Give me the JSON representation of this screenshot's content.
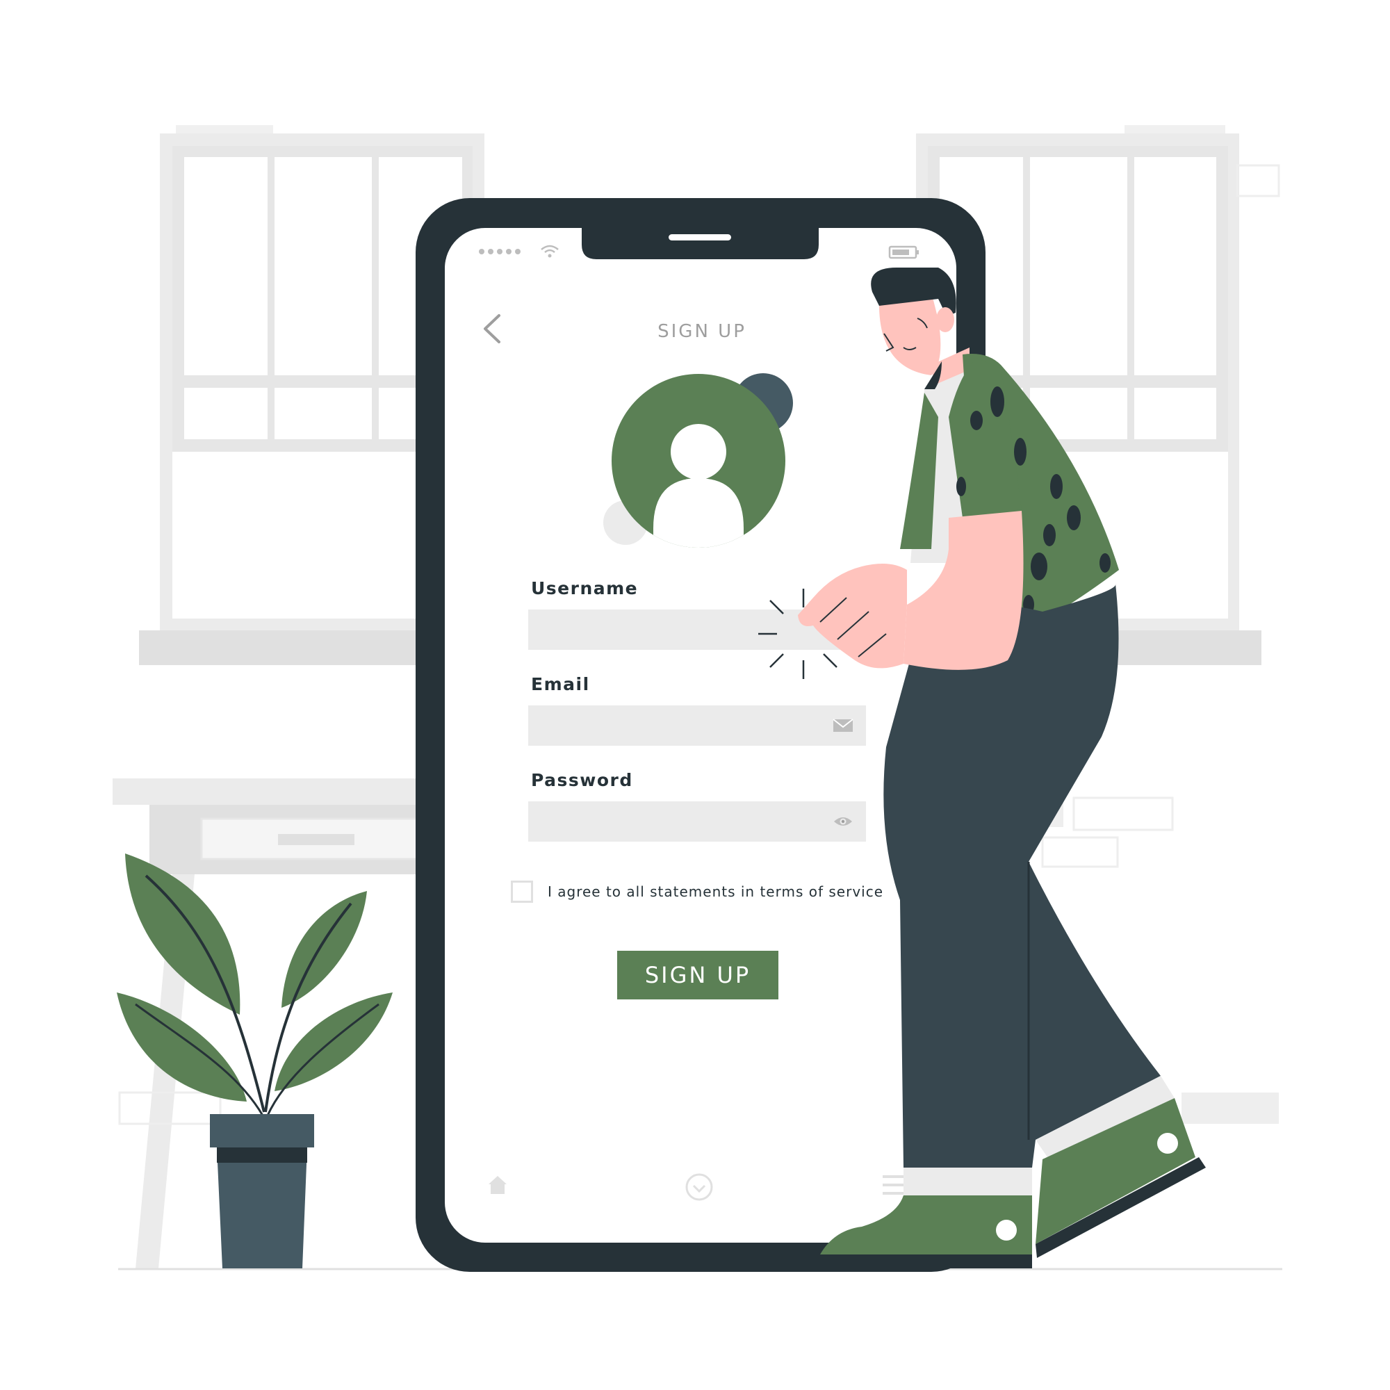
{
  "screen": {
    "title": "SIGN UP",
    "fields": [
      {
        "label": "Username",
        "value": "",
        "icon": ""
      },
      {
        "label": "Email",
        "value": "",
        "icon": "envelope-icon"
      },
      {
        "label": "Password",
        "value": "",
        "icon": "eye-icon"
      }
    ],
    "terms_label": "I agree to all statements in terms of service",
    "terms_checked": false,
    "submit_label": "SIGN UP",
    "icons": {
      "back": "chevron-left-icon",
      "avatar": "user-avatar-icon",
      "signal": "signal-dots-icon",
      "wifi": "wifi-icon",
      "battery": "battery-icon",
      "home": "home-icon",
      "check": "check-circle-icon",
      "menu": "menu-icon"
    }
  },
  "colors": {
    "accent_green": "#5b8055",
    "phone_frame": "#263238",
    "field_bg": "#ebebeb",
    "label_dark": "#263238",
    "muted_gray": "#9e9e9e",
    "pants": "#37474f",
    "skin": "#ffc3bd"
  }
}
